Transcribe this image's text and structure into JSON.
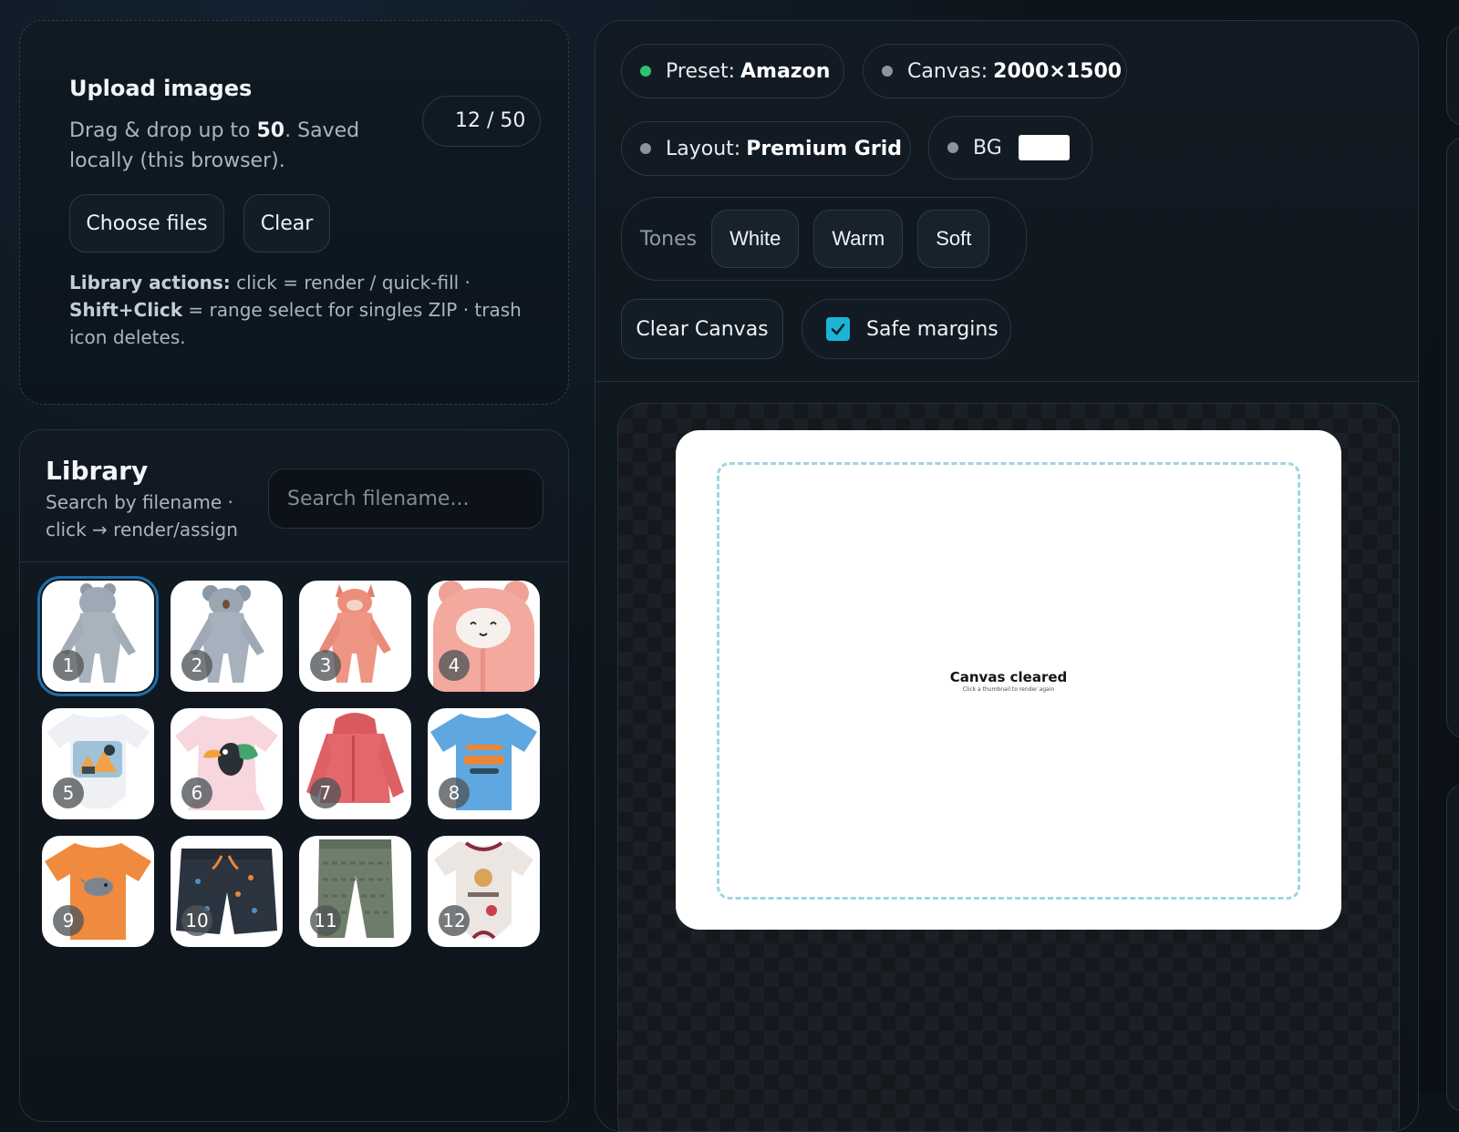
{
  "upload": {
    "title": "Upload images",
    "desc_prefix": "Drag & drop up to ",
    "desc_max": "50",
    "desc_suffix": ". Saved locally (this browser).",
    "count": "12 / 50",
    "choose_label": "Choose files",
    "clear_label": "Clear",
    "help_label": "Library actions:",
    "help_text1": " click = render / quick-fill · ",
    "help_label2": "Shift+Click",
    "help_text2": " = range select for singles ZIP · trash icon deletes."
  },
  "library": {
    "title": "Library",
    "subtitle": "Search by filename · click → render/assign",
    "search_placeholder": "Search filename...",
    "items": [
      {
        "num": "1",
        "selected": true
      },
      {
        "num": "2"
      },
      {
        "num": "3"
      },
      {
        "num": "4"
      },
      {
        "num": "5"
      },
      {
        "num": "6"
      },
      {
        "num": "7"
      },
      {
        "num": "8"
      },
      {
        "num": "9"
      },
      {
        "num": "10"
      },
      {
        "num": "11"
      },
      {
        "num": "12"
      }
    ]
  },
  "toolbar": {
    "preset_label": "Preset:",
    "preset_value": "Amazon",
    "canvas_label": "Canvas:",
    "canvas_value": "2000×1500",
    "layout_label": "Layout:",
    "layout_value": "Premium Grid",
    "bg_label": "BG",
    "bg_color": "#ffffff",
    "tones_label": "Tones",
    "tones": [
      "White",
      "Warm",
      "Soft"
    ],
    "clear_canvas_label": "Clear Canvas",
    "safe_margins_label": "Safe margins",
    "safe_margins_checked": true
  },
  "canvas": {
    "message": "Canvas cleared",
    "sub_message": "Click a thumbnail to render again"
  },
  "colors": {
    "accent": "#1bb4d6",
    "status_green": "#2bc46b",
    "selection": "#1f6ea8"
  }
}
